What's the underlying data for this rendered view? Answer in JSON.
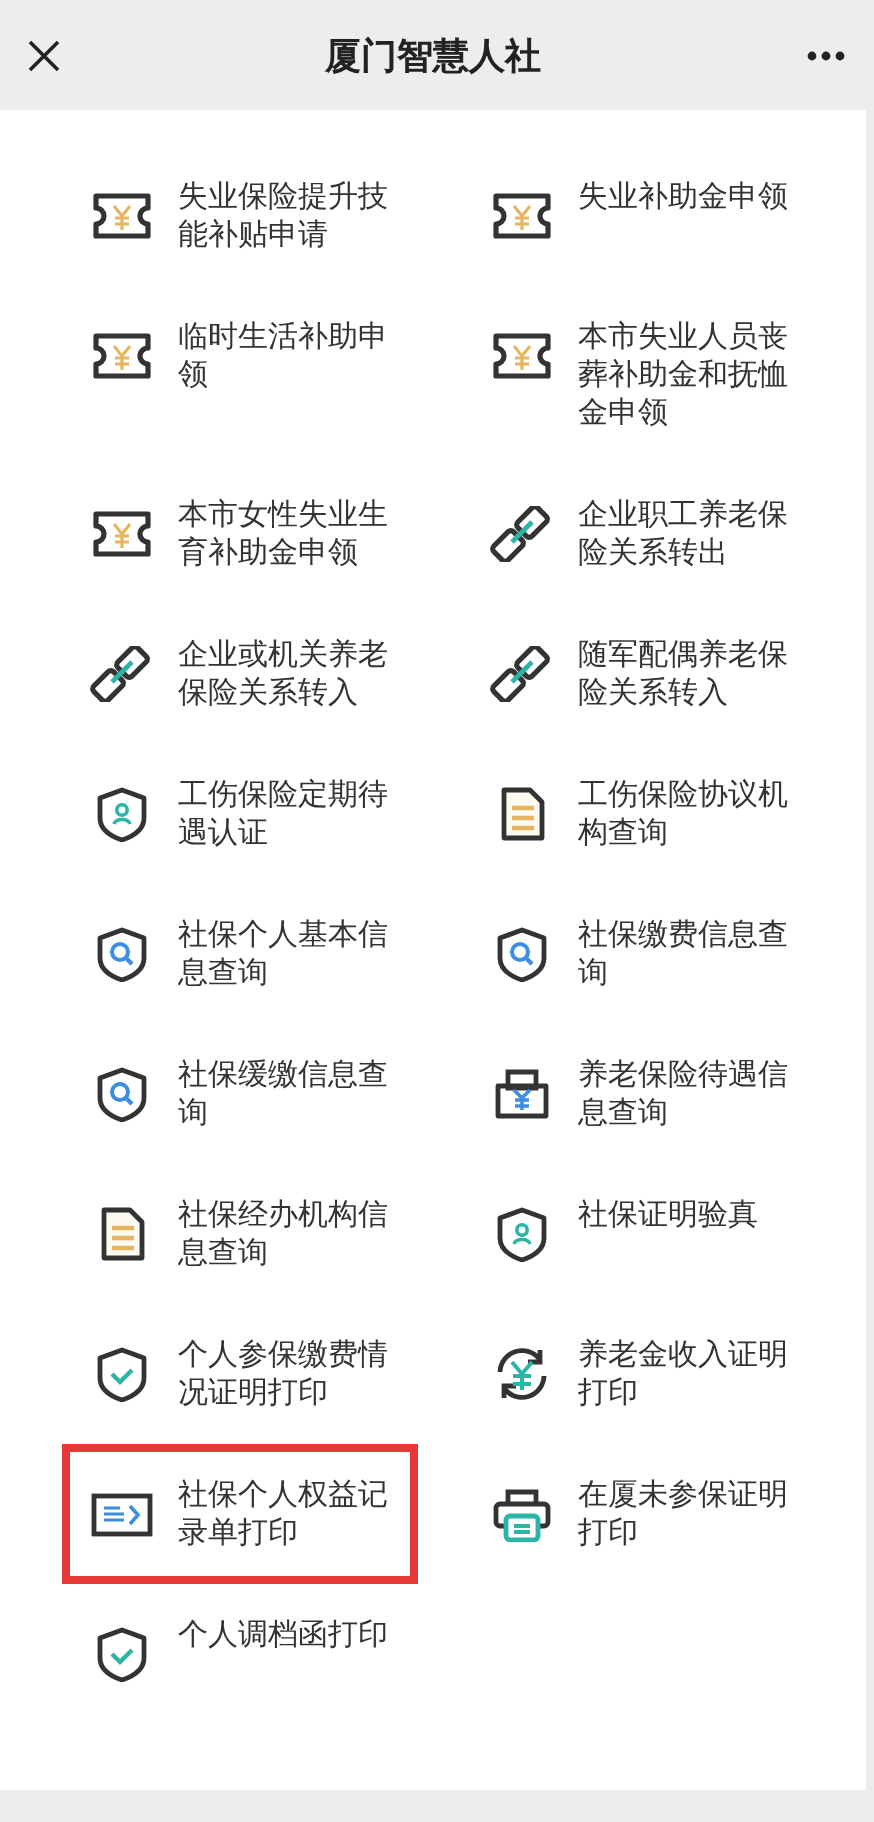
{
  "window": {
    "title": "厦门智慧人社"
  },
  "items": [
    {
      "label": "失业保险提升技能补贴申请",
      "kind": "ticket",
      "highlighted": false
    },
    {
      "label": "失业补助金申领",
      "kind": "ticket",
      "highlighted": false
    },
    {
      "label": "临时生活补助申领",
      "kind": "ticket",
      "highlighted": false
    },
    {
      "label": "本市失业人员丧葬补助金和抚恤金申领",
      "kind": "ticket",
      "highlighted": false
    },
    {
      "label": "本市女性失业生育补助金申领",
      "kind": "ticket",
      "highlighted": false
    },
    {
      "label": "企业职工养老保险关系转出",
      "kind": "link",
      "highlighted": false
    },
    {
      "label": "企业或机关养老保险关系转入",
      "kind": "link",
      "highlighted": false
    },
    {
      "label": "随军配偶养老保险关系转入",
      "kind": "link",
      "highlighted": false
    },
    {
      "label": "工伤保险定期待遇认证",
      "kind": "shield-person",
      "highlighted": false
    },
    {
      "label": "工伤保险协议机构查询",
      "kind": "document",
      "highlighted": false
    },
    {
      "label": "社保个人基本信息查询",
      "kind": "shield-search",
      "highlighted": false
    },
    {
      "label": "社保缴费信息查询",
      "kind": "shield-search",
      "highlighted": false
    },
    {
      "label": "社保缓缴信息查询",
      "kind": "shield-search",
      "highlighted": false
    },
    {
      "label": "养老保险待遇信息查询",
      "kind": "yen-tray",
      "highlighted": false
    },
    {
      "label": "社保经办机构信息查询",
      "kind": "document",
      "highlighted": false
    },
    {
      "label": "社保证明验真",
      "kind": "shield-person",
      "highlighted": false
    },
    {
      "label": "个人参保缴费情况证明打印",
      "kind": "shield-check",
      "highlighted": false
    },
    {
      "label": "养老金收入证明打印",
      "kind": "yen-cycle",
      "highlighted": false
    },
    {
      "label": "社保个人权益记录单打印",
      "kind": "card-arrow",
      "highlighted": true
    },
    {
      "label": "在厦未参保证明打印",
      "kind": "printer",
      "highlighted": false
    },
    {
      "label": "个人调档函打印",
      "kind": "shield-check",
      "highlighted": false
    }
  ]
}
